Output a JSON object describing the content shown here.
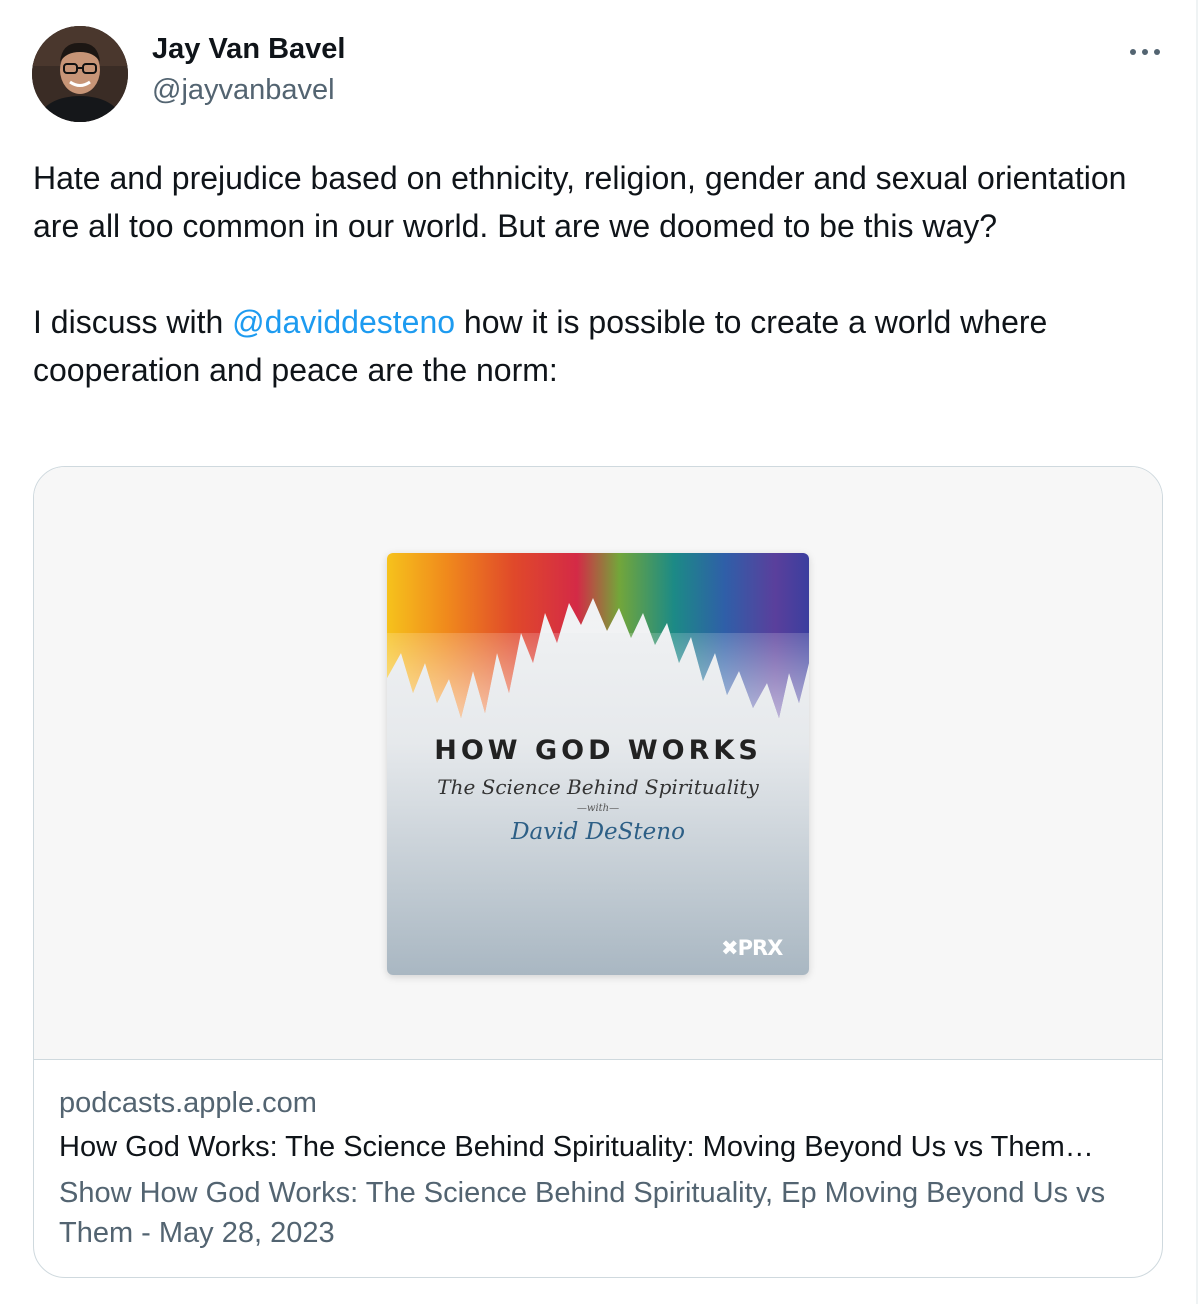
{
  "tweet": {
    "author_name": "Jay Van Bavel",
    "author_handle": "@jayvanbavel",
    "paragraph1": "Hate and prejudice based on ethnicity, religion, gender and sexual orientation are all too common in our world. But are we doomed to be this way?",
    "paragraph2_before": "I discuss with ",
    "mention": "@daviddesteno",
    "paragraph2_after": " how it is possible to create a world where cooperation and peace are the norm:"
  },
  "card": {
    "artwork": {
      "title": "HOW GOD WORKS",
      "subtitle": "The Science Behind Spirituality",
      "with_text": "—with—",
      "author": "David DeSteno",
      "brand": "PRX"
    },
    "domain": "podcasts.apple.com",
    "title": "How God Works: The Science Behind Spirituality: Moving Beyond Us vs Them…",
    "description": "Show How God Works: The Science Behind Spirituality, Ep Moving Beyond Us vs Them - May 28, 2023"
  },
  "icons": {
    "more": "more-horizontal-icon",
    "prx": "prx-x-icon"
  },
  "colors": {
    "link": "#1d9bf0",
    "secondary_text": "#536471",
    "border": "#cfd9de",
    "media_bg": "#f7f7f7",
    "artwork_author": "#2d5f86"
  }
}
